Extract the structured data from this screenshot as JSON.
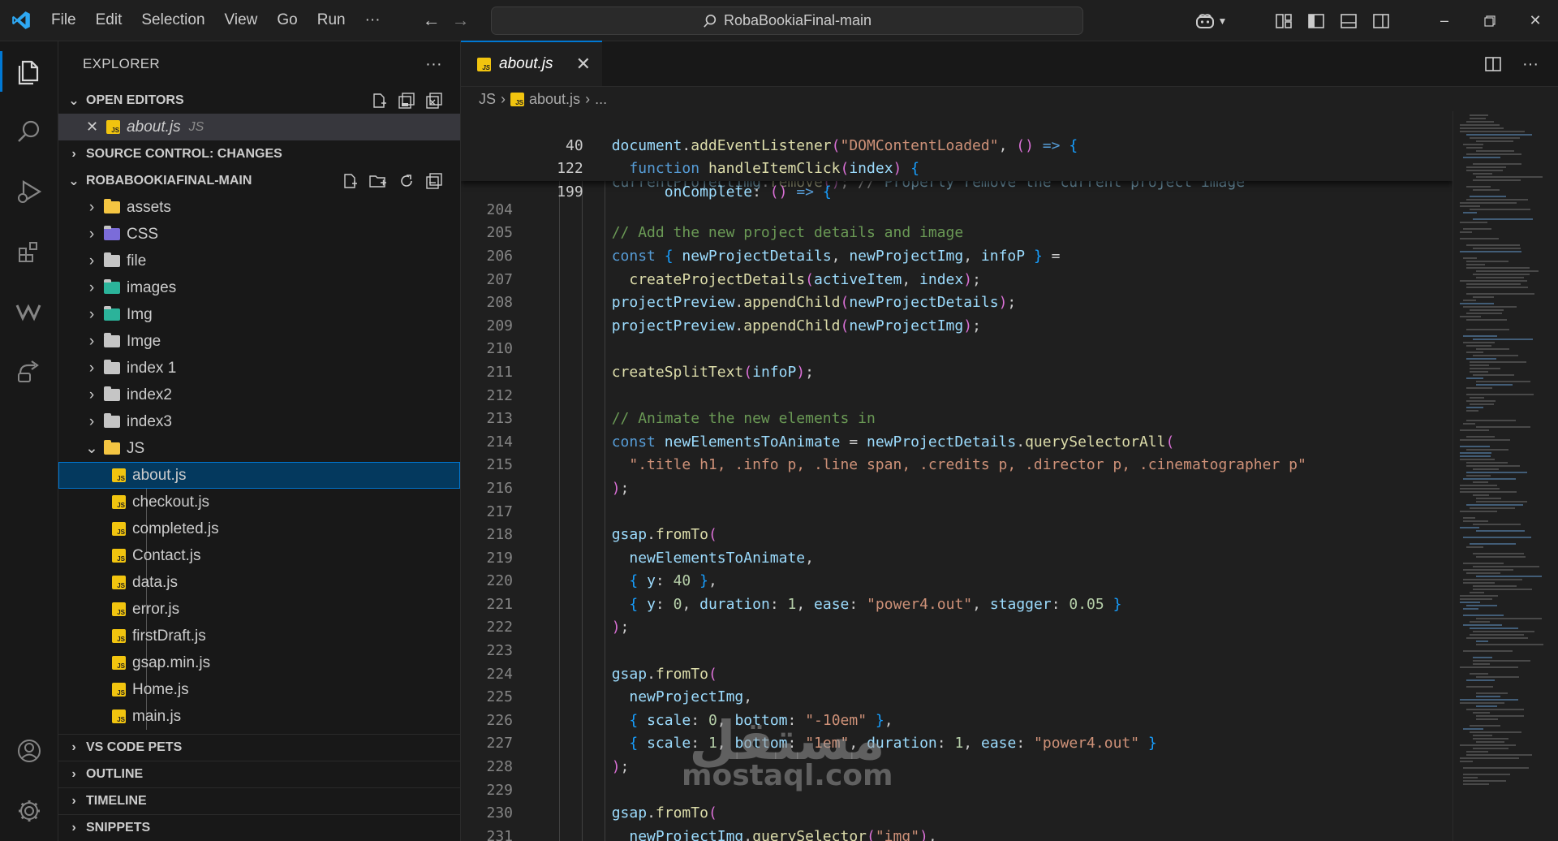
{
  "titlebar": {
    "menu": [
      "File",
      "Edit",
      "Selection",
      "View",
      "Go",
      "Run",
      "···"
    ],
    "search_text": "RobaBookiaFinal-main"
  },
  "sidebar": {
    "title": "EXPLORER",
    "more": "···",
    "open_editors": {
      "heading": "OPEN EDITORS",
      "items": [
        {
          "name": "about.js",
          "tag": "JS"
        }
      ]
    },
    "source_control_heading": "SOURCE CONTROL: CHANGES",
    "project": {
      "heading": "ROBABOOKIAFINAL-MAIN",
      "folders": [
        "assets",
        "CSS",
        "file",
        "images",
        "Img",
        "Imge",
        "index 1",
        "index2",
        "index3",
        "JS"
      ],
      "js_files": [
        "about.js",
        "checkout.js",
        "completed.js",
        "Contact.js",
        "data.js",
        "error.js",
        "firstDraft.js",
        "gsap.min.js",
        "Home.js",
        "main.js"
      ]
    },
    "bottom_sections": [
      "VS CODE PETS",
      "OUTLINE",
      "TIMELINE",
      "SNIPPETS"
    ]
  },
  "editor": {
    "tab": {
      "label": "about.js"
    },
    "breadcrumb": {
      "folder": "JS",
      "file": "about.js",
      "more": "..."
    },
    "sticky": [
      {
        "n": "40",
        "text": "document.addEventListener(\"DOMContentLoaded\", () => {"
      },
      {
        "n": "122",
        "text": "  function handleItemClick(index) {"
      },
      {
        "n": "199",
        "text": "      onComplete: () => {"
      }
    ],
    "peek_line": "        currentProjectImg.remove(); // Properly remove the current project image",
    "lines": [
      {
        "n": "204",
        "text": ""
      },
      {
        "n": "205",
        "text": "        // Add the new project details and image"
      },
      {
        "n": "206",
        "text": "        const { newProjectDetails, newProjectImg, infoP } ="
      },
      {
        "n": "207",
        "text": "          createProjectDetails(activeItem, index);"
      },
      {
        "n": "208",
        "text": "        projectPreview.appendChild(newProjectDetails);"
      },
      {
        "n": "209",
        "text": "        projectPreview.appendChild(newProjectImg);"
      },
      {
        "n": "210",
        "text": ""
      },
      {
        "n": "211",
        "text": "        createSplitText(infoP);"
      },
      {
        "n": "212",
        "text": ""
      },
      {
        "n": "213",
        "text": "        // Animate the new elements in"
      },
      {
        "n": "214",
        "text": "        const newElementsToAnimate = newProjectDetails.querySelectorAll("
      },
      {
        "n": "215",
        "text": "          \".title h1, .info p, .line span, .credits p, .director p, .cinematographer p\""
      },
      {
        "n": "216",
        "text": "        );"
      },
      {
        "n": "217",
        "text": ""
      },
      {
        "n": "218",
        "text": "        gsap.fromTo("
      },
      {
        "n": "219",
        "text": "          newElementsToAnimate,"
      },
      {
        "n": "220",
        "text": "          { y: 40 },"
      },
      {
        "n": "221",
        "text": "          { y: 0, duration: 1, ease: \"power4.out\", stagger: 0.05 }"
      },
      {
        "n": "222",
        "text": "        );"
      },
      {
        "n": "223",
        "text": ""
      },
      {
        "n": "224",
        "text": "        gsap.fromTo("
      },
      {
        "n": "225",
        "text": "          newProjectImg,"
      },
      {
        "n": "226",
        "text": "          { scale: 0, bottom: \"-10em\" },"
      },
      {
        "n": "227",
        "text": "          { scale: 1, bottom: \"1em\", duration: 1, ease: \"power4.out\" }"
      },
      {
        "n": "228",
        "text": "        );"
      },
      {
        "n": "229",
        "text": ""
      },
      {
        "n": "230",
        "text": "        gsap.fromTo("
      },
      {
        "n": "231",
        "text": "          newProjectImg.querySelector(\"img\"),"
      }
    ]
  },
  "watermark": {
    "arabic": "مستقل",
    "latin": "mostaql.com"
  },
  "colors": {
    "accent": "#0078d4",
    "keyword": "#569cd6",
    "function": "#dcdcaa",
    "string": "#ce9178",
    "variable": "#9cdcfe",
    "number": "#b5cea8",
    "comment": "#6a9955",
    "js_icon": "#f1c40f"
  }
}
